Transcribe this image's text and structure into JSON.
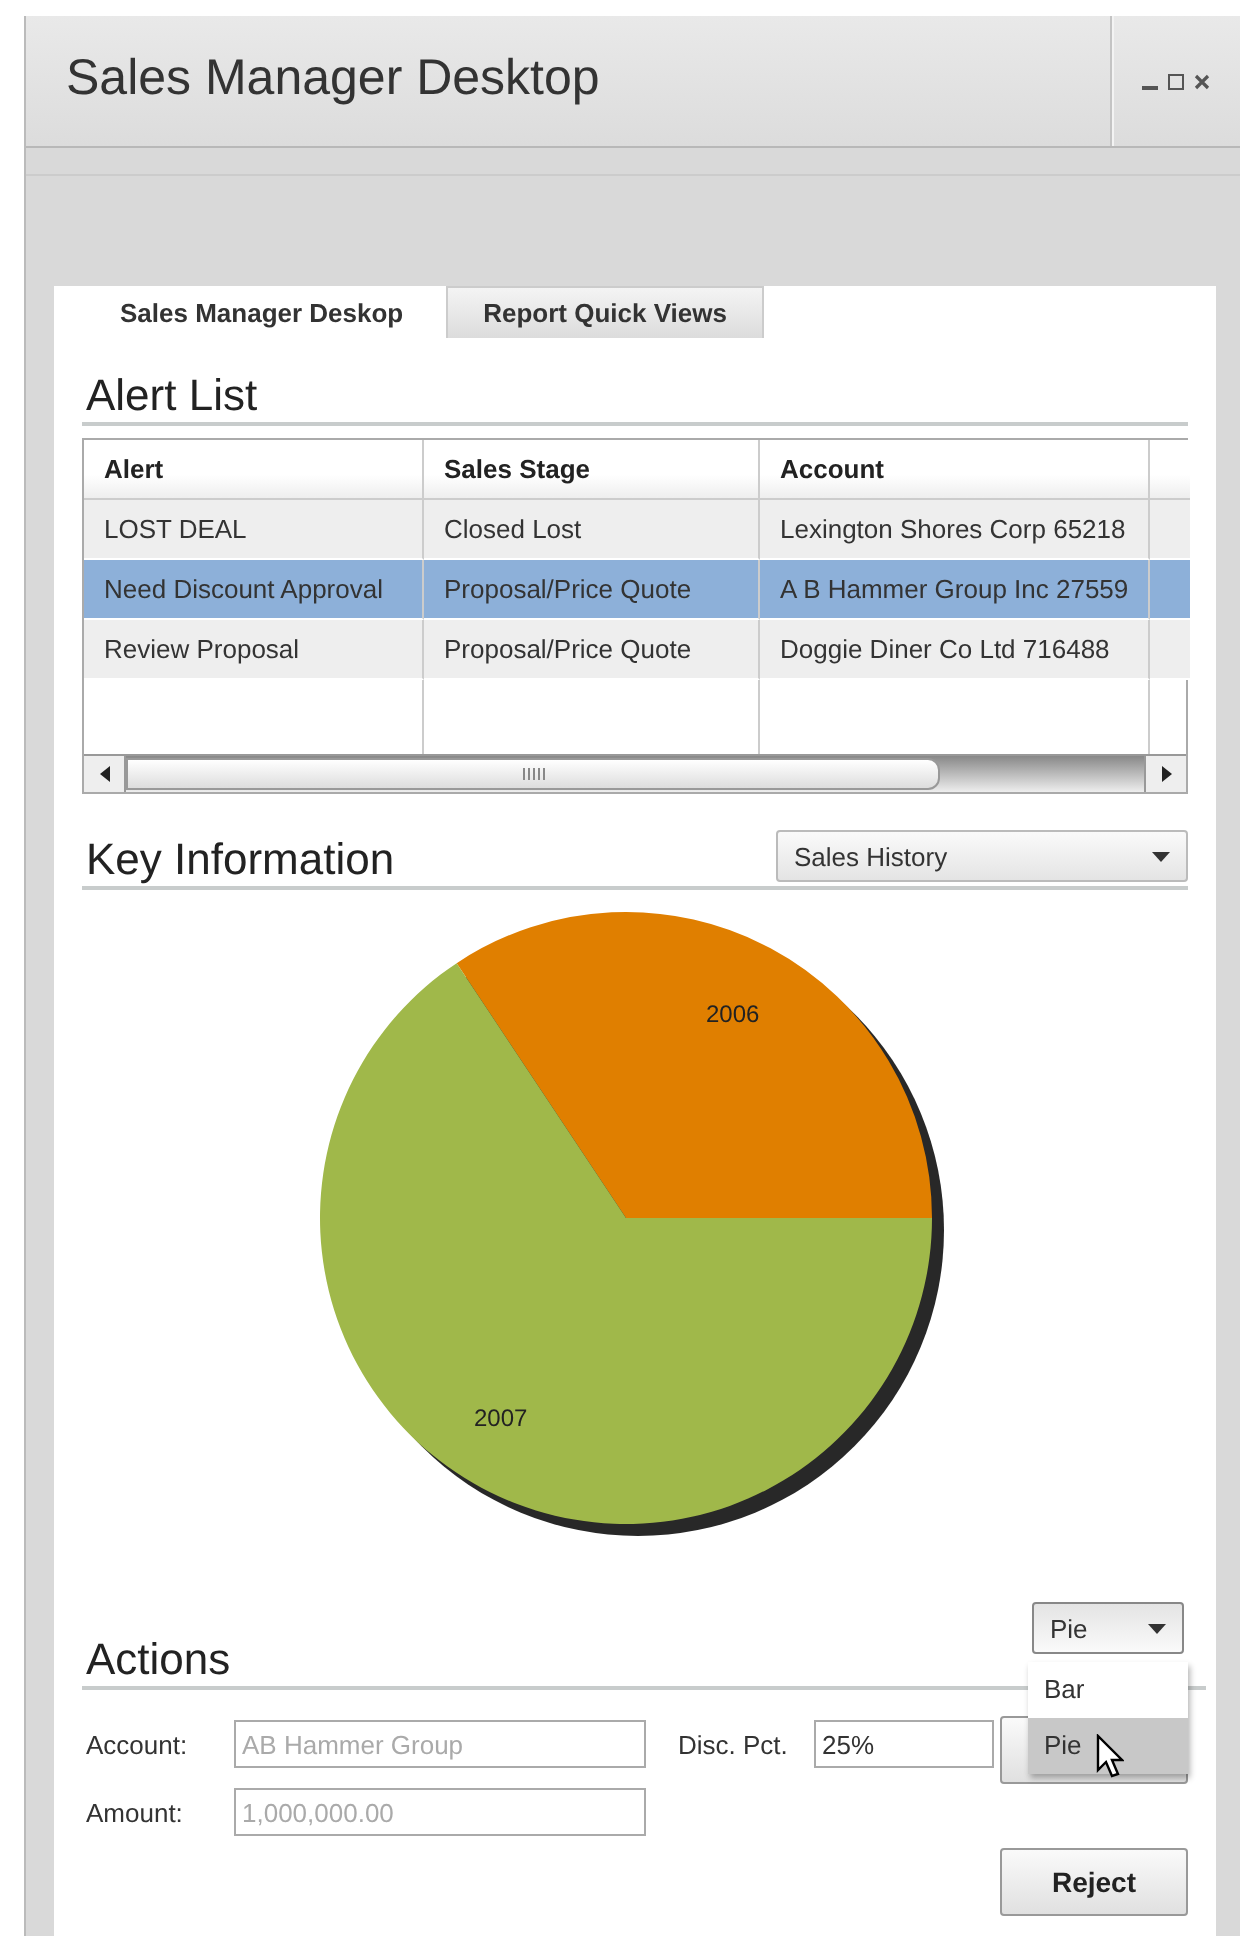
{
  "window": {
    "title": "Sales Manager Desktop"
  },
  "tabs": [
    {
      "label": "Sales Manager Deskop",
      "selected": true
    },
    {
      "label": "Report Quick Views",
      "selected": false
    }
  ],
  "alert_list": {
    "heading": "Alert List",
    "columns": [
      "Alert",
      "Sales Stage",
      "Account"
    ],
    "rows": [
      {
        "cells": [
          "LOST DEAL",
          "Closed Lost",
          "Lexington Shores Corp 65218"
        ],
        "selected": false
      },
      {
        "cells": [
          "Need Discount Approval",
          "Proposal/Price Quote",
          "A B Hammer Group Inc 27559"
        ],
        "selected": true
      },
      {
        "cells": [
          "Review Proposal",
          "Proposal/Price Quote",
          "Doggie Diner Co Ltd 716488"
        ],
        "selected": false
      }
    ]
  },
  "key_information": {
    "heading": "Key Information",
    "view_select": {
      "value": "Sales History"
    },
    "pie": {
      "slices": [
        {
          "label": "2006",
          "color": "#e07f00"
        },
        {
          "label": "2007",
          "color": "#a0b84a"
        }
      ]
    },
    "chart_type_select": {
      "value": "Pie",
      "expanded": true,
      "options": [
        {
          "label": "Bar",
          "selected": false
        },
        {
          "label": "Pie",
          "selected": true
        }
      ]
    }
  },
  "actions": {
    "heading": "Actions",
    "fields": [
      {
        "label": "Account:",
        "value": "AB Hammer Group",
        "disabled": true
      },
      {
        "label": "Disc. Pct.",
        "value": "25%",
        "disabled": false
      },
      {
        "label": "Amount:",
        "value": "1,000,000.00",
        "disabled": true
      }
    ],
    "buttons": [
      "Reject"
    ]
  }
}
